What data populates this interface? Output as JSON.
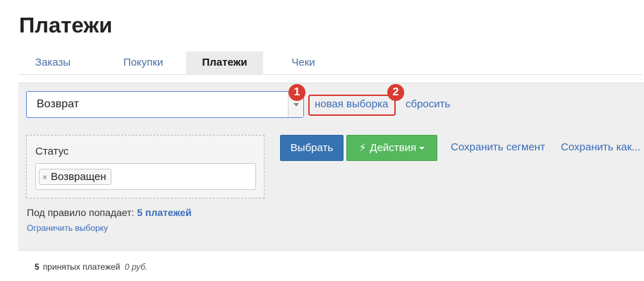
{
  "page": {
    "title": "Платежи"
  },
  "tabs": [
    {
      "label": "Заказы",
      "active": false
    },
    {
      "label": "Покупки",
      "active": false
    },
    {
      "label": "Платежи",
      "active": true
    },
    {
      "label": "Чеки",
      "active": false
    }
  ],
  "filter_bar": {
    "preset_value": "Возврат",
    "new_selection_label": "новая выборка",
    "reset_label": "сбросить",
    "markers": [
      "1",
      "2"
    ]
  },
  "condition": {
    "label": "Статус",
    "token": "Возвращен",
    "remove_glyph": "×"
  },
  "actions": {
    "select_label": "Выбрать",
    "actions_label": "Действия",
    "save_segment_label": "Сохранить сегмент",
    "save_as_label": "Сохранить как..."
  },
  "rule": {
    "prefix": "Под правило попадает:",
    "count": "5 платежей",
    "limit_label": "Ограничить выборку"
  },
  "summary": {
    "count": "5",
    "text": "принятых платежей",
    "amount": "0 руб."
  },
  "colors": {
    "primary": "#3773b2",
    "success": "#55b85d",
    "link": "#3a6cb8",
    "highlight": "#d93a32"
  }
}
